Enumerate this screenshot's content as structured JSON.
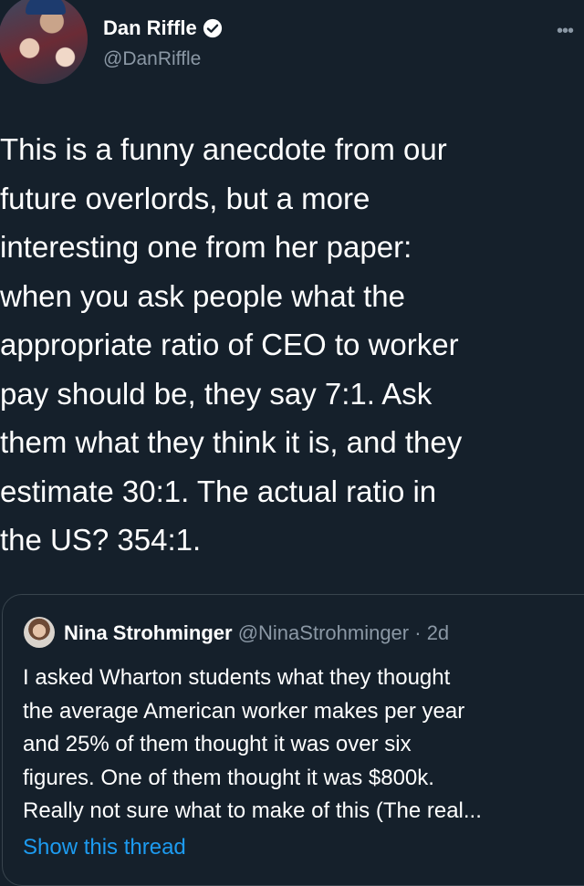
{
  "author": {
    "display_name": "Dan Riffle",
    "handle": "@DanRiffle",
    "verified": true
  },
  "more_menu": "•••",
  "tweet": {
    "text": "This is a funny anecdote from our\nfuture overlords, but a more\ninteresting one from her paper:\nwhen you ask people what the\nappropriate ratio of CEO to worker\npay should be, they say 7:1. Ask\nthem what they think it is, and they\nestimate 30:1. The actual ratio in\nthe US? 354:1."
  },
  "quoted_tweet": {
    "display_name": "Nina Strohminger",
    "handle": "@NinaStrohminger",
    "separator": "·",
    "age": "2d",
    "text": "I asked Wharton students what they thought\nthe average American worker makes per year\nand 25% of them thought it was over six\nfigures. One of them thought it was $800k.\nReally not sure what to make of this (The real...",
    "show_thread": "Show this thread"
  },
  "colors": {
    "background": "#15202b",
    "text": "#ffffff",
    "secondary_text": "#8b98a5",
    "link": "#1d9bf0",
    "border": "#38444d"
  }
}
